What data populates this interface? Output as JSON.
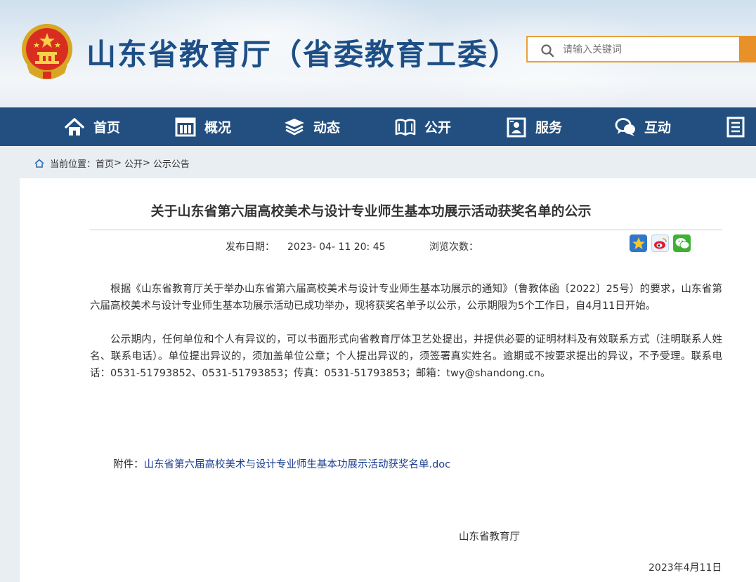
{
  "header": {
    "site_title": "山东省教育厅（省委教育工委）",
    "search_placeholder": "请输入关键词"
  },
  "nav": {
    "items": [
      {
        "label": "首页",
        "icon": "home-icon"
      },
      {
        "label": "概况",
        "icon": "building-icon"
      },
      {
        "label": "动态",
        "icon": "layers-icon"
      },
      {
        "label": "公开",
        "icon": "book-icon"
      },
      {
        "label": "服务",
        "icon": "service-icon"
      },
      {
        "label": "互动",
        "icon": "chat-icon"
      }
    ]
  },
  "breadcrumb": {
    "prefix": "当前位置：",
    "items": [
      "首页",
      "公开",
      "公示公告"
    ],
    "separator": ">"
  },
  "article": {
    "title": "关于山东省第六届高校美术与设计专业师生基本功展示活动获奖名单的公示",
    "publish_label": "发布日期：",
    "publish_date": "2023- 04- 11 20: 45",
    "views_label": "浏览次数：",
    "paragraphs": [
      "根据《山东省教育厅关于举办山东省第六届高校美术与设计专业师生基本功展示的通知》（鲁教体函〔2022〕25号）的要求，山东省第六届高校美术与设计专业师生基本功展示活动已成功举办，现将获奖名单予以公示，公示期限为5个工作日，自4月11日开始。",
      "公示期内，任何单位和个人有异议的，可以书面形式向省教育厅体卫艺处提出，并提供必要的证明材料及有效联系方式（注明联系人姓名、联系电话）。单位提出异议的，须加盖单位公章；个人提出异议的，须签署真实姓名。逾期或不按要求提出的异议，不予受理。联系电话：0531-51793852、0531-51793853；传真：0531-51793853；邮箱：twy@shandong.cn。"
    ],
    "attachment_label": "附件：",
    "attachment_link": "山东省第六届高校美术与设计专业师生基本功展示活动获奖名单.doc",
    "signature": "山东省教育厅",
    "date": "2023年4月11日"
  },
  "share": [
    "qzone-icon",
    "weibo-icon",
    "wechat-icon"
  ],
  "colors": {
    "nav_bg": "#224f80",
    "title_blue": "#1d4f86",
    "search_accent": "#e8912a",
    "link": "#1a3d8f"
  }
}
